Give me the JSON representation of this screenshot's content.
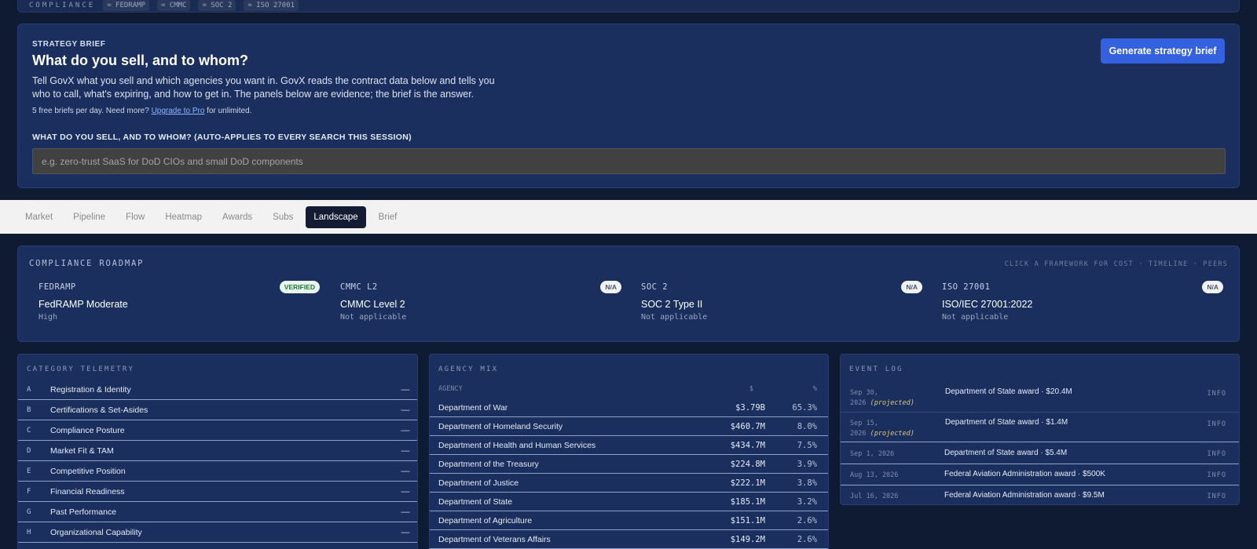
{
  "top_strip": {
    "label": "COMPLIANCE",
    "chips": [
      "= FEDRAMP",
      "= CMMC",
      "= SOC 2",
      "= ISO 27001"
    ]
  },
  "brief": {
    "eyebrow": "STRATEGY BRIEF",
    "title": "What do you sell, and to whom?",
    "description": "Tell GovX what you sell and which agencies you want in. GovX reads the contract data below and tells you who to call, what's expiring, and how to get in. The panels below are evidence; the brief is the answer.",
    "limit_prefix": "5 free briefs per day. Need more?",
    "limit_link": "Upgrade to Pro",
    "limit_suffix": "for unlimited.",
    "question_label": "WHAT DO YOU SELL, AND TO WHOM? (AUTO-APPLIES TO EVERY SEARCH THIS SESSION)",
    "input_placeholder": "e.g. zero-trust SaaS for DoD CIOs and small DoD components",
    "generate_label": "Generate strategy brief"
  },
  "tabs": [
    {
      "label": "Market",
      "active": false
    },
    {
      "label": "Pipeline",
      "active": false
    },
    {
      "label": "Flow",
      "active": false
    },
    {
      "label": "Heatmap",
      "active": false
    },
    {
      "label": "Awards",
      "active": false
    },
    {
      "label": "Subs",
      "active": false
    },
    {
      "label": "Landscape",
      "active": true
    },
    {
      "label": "Brief",
      "active": false
    }
  ],
  "roadmap": {
    "title": "COMPLIANCE ROADMAP",
    "hint": "CLICK A FRAMEWORK FOR COST · TIMELINE · PEERS",
    "frameworks": [
      {
        "code": "FEDRAMP",
        "badge": "VERIFIED",
        "name": "FedRAMP Moderate",
        "status": "High"
      },
      {
        "code": "CMMC L2",
        "badge": "N/A",
        "name": "CMMC Level 2",
        "status": "Not applicable"
      },
      {
        "code": "SOC 2",
        "badge": "N/A",
        "name": "SOC 2 Type II",
        "status": "Not applicable"
      },
      {
        "code": "ISO 27001",
        "badge": "N/A",
        "name": "ISO/IEC 27001:2022",
        "status": "Not applicable"
      }
    ]
  },
  "category_telemetry": {
    "title": "CATEGORY TELEMETRY",
    "rows": [
      {
        "key": "A",
        "label": "Registration & Identity",
        "value": "—"
      },
      {
        "key": "B",
        "label": "Certifications & Set-Asides",
        "value": "—"
      },
      {
        "key": "C",
        "label": "Compliance Posture",
        "value": "—"
      },
      {
        "key": "D",
        "label": "Market Fit & TAM",
        "value": "—"
      },
      {
        "key": "E",
        "label": "Competitive Position",
        "value": "—"
      },
      {
        "key": "F",
        "label": "Financial Readiness",
        "value": "—"
      },
      {
        "key": "G",
        "label": "Past Performance",
        "value": "—"
      },
      {
        "key": "H",
        "label": "Organizational Capability",
        "value": "—"
      }
    ]
  },
  "agency_mix": {
    "title": "AGENCY MIX",
    "columns": {
      "agency": "AGENCY",
      "dollars": "$",
      "percent": "%"
    },
    "rows": [
      {
        "name": "Department of War",
        "dollars": "$3.79B",
        "percent": "65.3%"
      },
      {
        "name": "Department of Homeland Security",
        "dollars": "$460.7M",
        "percent": "8.0%"
      },
      {
        "name": "Department of Health and Human Services",
        "dollars": "$434.7M",
        "percent": "7.5%"
      },
      {
        "name": "Department of the Treasury",
        "dollars": "$224.8M",
        "percent": "3.9%"
      },
      {
        "name": "Department of Justice",
        "dollars": "$222.1M",
        "percent": "3.8%"
      },
      {
        "name": "Department of State",
        "dollars": "$185.1M",
        "percent": "3.2%"
      },
      {
        "name": "Department of Agriculture",
        "dollars": "$151.1M",
        "percent": "2.6%"
      },
      {
        "name": "Department of Veterans Affairs",
        "dollars": "$149.2M",
        "percent": "2.6%"
      }
    ]
  },
  "event_log": {
    "title": "EVENT LOG",
    "rows": [
      {
        "date": "Sep 30,",
        "date2": "2026",
        "projected": "(projected)",
        "text": "Department of State award · $20.4M",
        "level": "INFO"
      },
      {
        "date": "Sep 15,",
        "date2": "2026",
        "projected": "(projected)",
        "text": "Department of State award · $1.4M",
        "level": "INFO"
      },
      {
        "date": "Sep 1, 2026",
        "date2": "",
        "projected": "",
        "text": "Department of State award · $5.4M",
        "level": "INFO"
      },
      {
        "date": "Aug 13, 2026",
        "date2": "",
        "projected": "",
        "text": "Federal Aviation Administration award · $500K",
        "level": "INFO"
      },
      {
        "date": "Jul 16, 2026",
        "date2": "",
        "projected": "",
        "text": "Federal Aviation Administration award · $9.5M",
        "level": "INFO"
      }
    ]
  },
  "colors": {
    "page_bg": "#0f1a33",
    "panel_bg": "#1a2f5e",
    "accent_button": "#3461e0",
    "projected_text": "#e2c772"
  }
}
